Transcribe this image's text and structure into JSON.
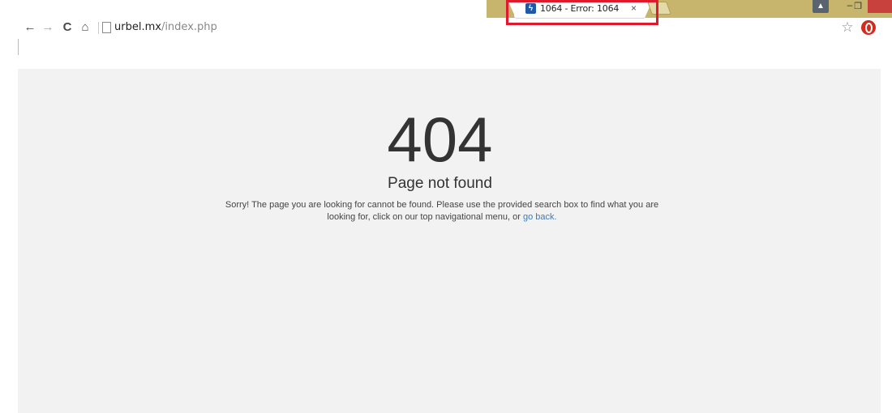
{
  "browser": {
    "tab": {
      "title": "1064 - Error: 1064",
      "close_glyph": "×",
      "favicon": "lightning-favicon-icon"
    },
    "window_controls": {
      "user_icon": "user-icon",
      "minimize_glyph": "–",
      "restore_glyph": "❐",
      "close_icon": "close-window-icon"
    },
    "toolbar": {
      "back_icon": "←",
      "forward_icon": "→",
      "reload_icon": "C",
      "home_icon": "⌂",
      "star_icon": "☆",
      "extension_icon": "opera-extension-icon"
    },
    "address": {
      "host": "urbel.mx",
      "path": "/index.php"
    },
    "highlight_color": "#e0192c"
  },
  "page": {
    "code": "404",
    "title": "Page not found",
    "message": "Sorry! The page you are looking for cannot be found. Please use the provided search box to find what you are looking for, click on our top navigational menu, or",
    "link_text": "go back.",
    "background": "#f2f2f2",
    "link_color": "#3a7bbf"
  }
}
